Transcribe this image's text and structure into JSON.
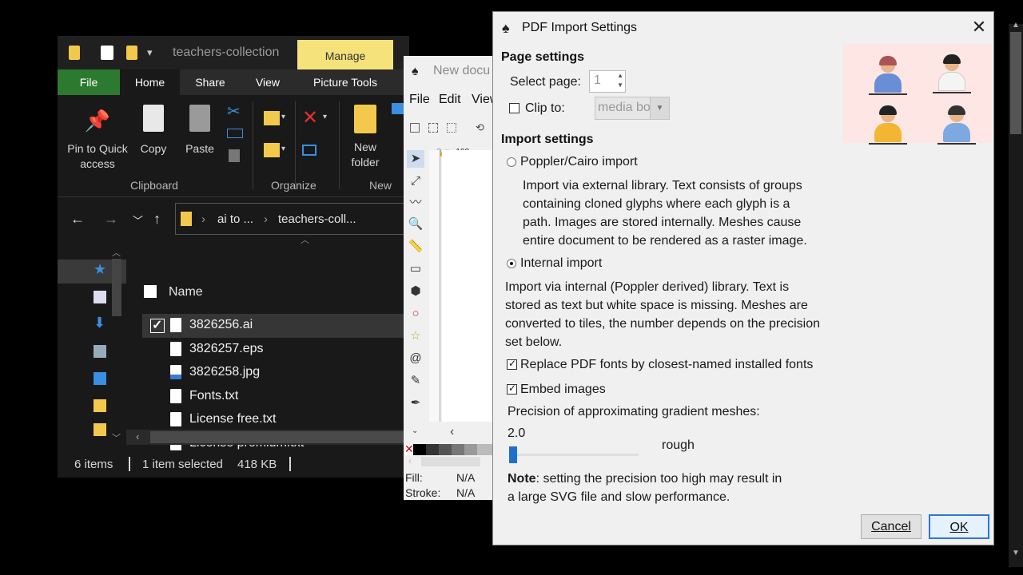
{
  "explorer": {
    "title": "teachers-collection",
    "manage_tab": "Manage",
    "tabs": [
      "File",
      "Home",
      "Share",
      "View",
      "Picture Tools"
    ],
    "ribbon": {
      "pin_label_1": "Pin to Quick",
      "pin_label_2": "access",
      "copy_label": "Copy",
      "paste_label": "Paste",
      "new_folder_label_1": "New",
      "new_folder_label_2": "folder",
      "groups": [
        "Clipboard",
        "Organize",
        "New"
      ]
    },
    "address": {
      "crumb1": "ai to ...",
      "crumb2": "teachers-coll..."
    },
    "list": {
      "column_name": "Name",
      "files": [
        "3826256.ai",
        "3826257.eps",
        "3826258.jpg",
        "Fonts.txt",
        "License free.txt",
        "License premium.txt"
      ]
    },
    "status": {
      "items": "6 items",
      "selected": "1 item selected",
      "size": "418 KB"
    }
  },
  "inkscape": {
    "title": "New docu",
    "menu": [
      "File",
      "Edit",
      "View"
    ],
    "ruler_h": "-100",
    "fill_label": "Fill:",
    "fill_value": "N/A",
    "stroke_label": "Stroke:",
    "stroke_value": "N/A"
  },
  "dialog": {
    "title": "PDF Import Settings",
    "page_settings": "Page settings",
    "select_page_label": "Select page:",
    "select_page_value": "1",
    "clip_label": "Clip to:",
    "clip_value": "media box",
    "import_settings": "Import settings",
    "poppler_label": "Poppler/Cairo import",
    "poppler_desc": [
      "Import via external library. Text consists of groups",
      "containing cloned glyphs where each glyph is a",
      "path. Images are stored internally. Meshes cause",
      "entire document to be rendered as a raster image."
    ],
    "internal_label": "Internal import",
    "internal_desc": [
      "Import via internal (Poppler derived) library. Text is",
      "stored as text but white space is missing. Meshes are",
      "converted to tiles, the number depends on the precision",
      "set below."
    ],
    "replace_fonts_label": "Replace PDF fonts by closest-named installed fonts",
    "embed_images_label": "Embed images",
    "precision_label": "Precision of approximating gradient meshes:",
    "precision_value": "2.0",
    "precision_desc": "rough",
    "note_bold": "Note",
    "note_rest_1": ": setting the precision too high may result in",
    "note_rest_2": "a large SVG file and slow performance.",
    "cancel_label": "Cancel",
    "ok_label": "OK",
    "selected_import": "internal",
    "clip_checked": false,
    "replace_fonts_checked": true,
    "embed_images_checked": true,
    "precision_fraction": 0.0
  },
  "colors": {
    "file_tab": "#2c7a2f",
    "manage": "#f5e27a",
    "accent": "#1f6fd1"
  }
}
